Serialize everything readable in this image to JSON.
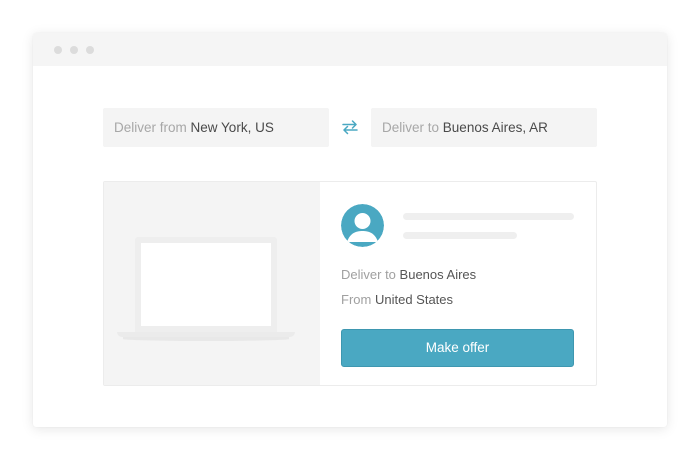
{
  "route": {
    "from_label": "Deliver from",
    "from_value": "New York, US",
    "to_label": "Deliver to",
    "to_value": "Buenos Aires, AR"
  },
  "offer_card": {
    "deliver_label": "Deliver to",
    "deliver_value": "Buenos Aires",
    "from_label": "From",
    "from_value": "United States",
    "button_label": "Make offer"
  },
  "icons": {
    "swap": "swap-arrows-icon",
    "avatar": "user-avatar-icon",
    "product": "laptop-icon"
  },
  "colors": {
    "accent": "#4aa8c2",
    "field_background": "#f4f4f4",
    "muted_text": "#a7a7a7",
    "value_text": "#4a4a4a"
  }
}
